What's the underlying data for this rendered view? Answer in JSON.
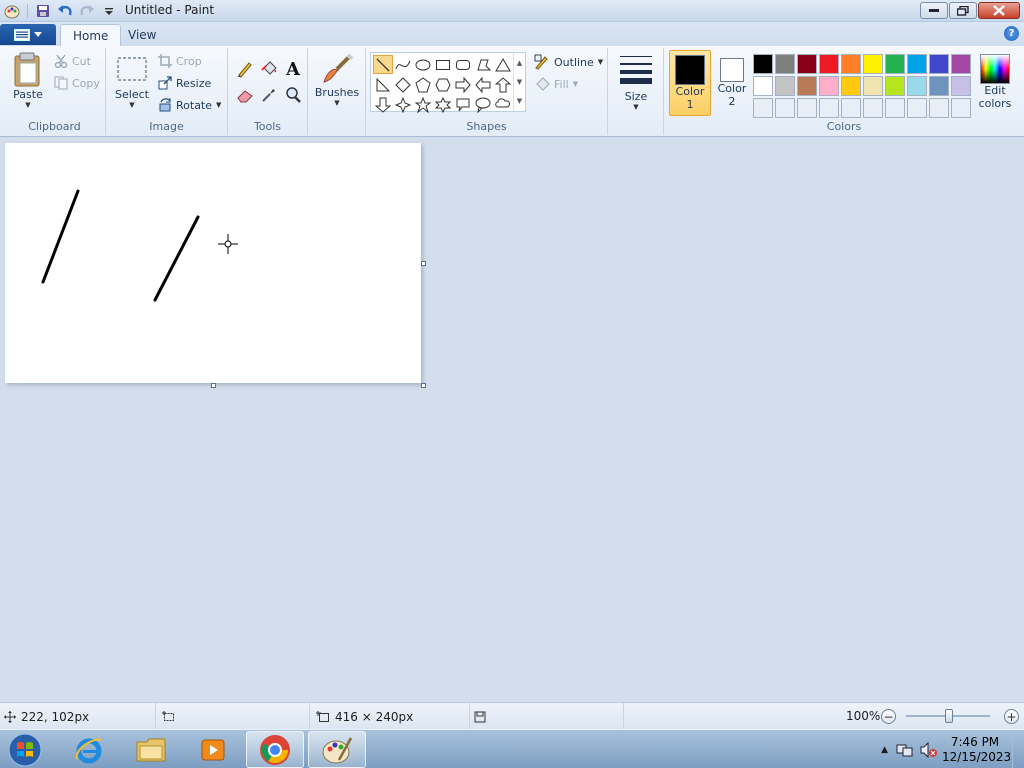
{
  "window": {
    "title": "Untitled - Paint"
  },
  "tabs": [
    {
      "label": "Home"
    },
    {
      "label": "View"
    }
  ],
  "help_icon": "?",
  "clipboard": {
    "paste": "Paste",
    "cut": "Cut",
    "copy": "Copy",
    "group": "Clipboard"
  },
  "image": {
    "select": "Select",
    "crop": "Crop",
    "resize": "Resize",
    "rotate": "Rotate",
    "group": "Image"
  },
  "tools": {
    "group": "Tools",
    "text_glyph": "A"
  },
  "brushes": {
    "label": "Brushes"
  },
  "shapes": {
    "outline": "Outline",
    "fill": "Fill",
    "group": "Shapes"
  },
  "size": {
    "label": "Size"
  },
  "colors": {
    "color1_label": "Color",
    "color1_num": "1",
    "color2_label": "Color",
    "color2_num": "2",
    "edit_label": "Edit",
    "edit_label2": "colors",
    "group": "Colors",
    "color1": "#000000",
    "color2": "#ffffff",
    "palette": [
      "#000000",
      "#7f7f7f",
      "#880015",
      "#ed1c24",
      "#ff7f27",
      "#fff200",
      "#22b14c",
      "#00a2e8",
      "#3f48cc",
      "#a349a4",
      "#ffffff",
      "#c3c3c3",
      "#b97a57",
      "#ffaec9",
      "#ffc90e",
      "#efe4b0",
      "#b5e61d",
      "#99d9ea",
      "#7092be",
      "#c8bfe7",
      "#e8eef6",
      "#e8eef6",
      "#e8eef6",
      "#e8eef6",
      "#e8eef6",
      "#e8eef6",
      "#e8eef6",
      "#e8eef6",
      "#e8eef6",
      "#e8eef6"
    ]
  },
  "status": {
    "cursor_pos": "222, 102px",
    "canvas_size": "416 × 240px",
    "zoom": "100%",
    "zoom_minus": "−",
    "zoom_plus": "+"
  },
  "taskbar": {
    "apps": [
      "windows-start",
      "internet-explorer",
      "file-explorer",
      "media-player",
      "chrome",
      "paint"
    ],
    "time": "7:46 PM",
    "date": "12/15/2023"
  }
}
